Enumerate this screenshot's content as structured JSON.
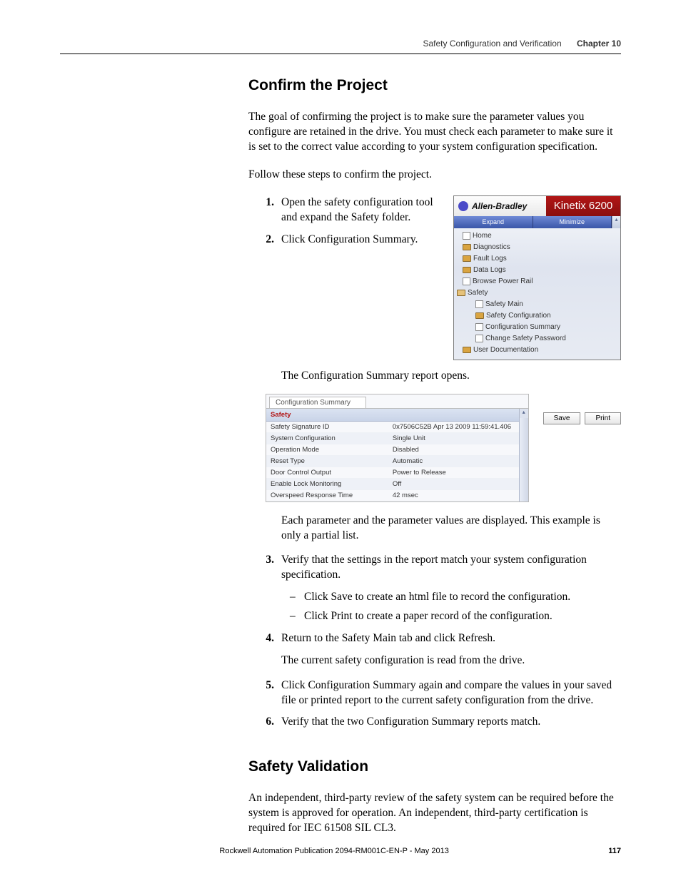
{
  "header": {
    "title": "Safety Configuration and Verification",
    "chapter": "Chapter 10"
  },
  "section1": {
    "heading": "Confirm the Project",
    "intro": "The goal of confirming the project is to make sure the parameter values you configure are retained in the drive. You must check each parameter to make sure it is set to the correct value according to your system configuration specification.",
    "follow": "Follow these steps to confirm the project."
  },
  "steps_top": {
    "s1": {
      "num": "1.",
      "text": "Open the safety configuration tool and expand the Safety folder."
    },
    "s2": {
      "num": "2.",
      "text": "Click Configuration Summary."
    }
  },
  "nav": {
    "brand_left": "Allen-Bradley",
    "brand_right": "Kinetix 6200",
    "tab_expand": "Expand",
    "tab_minimize": "Minimize",
    "items": {
      "home": "Home",
      "diag": "Diagnostics",
      "fault": "Fault Logs",
      "data": "Data Logs",
      "browse": "Browse Power Rail",
      "safety": "Safety",
      "safety_main": "Safety Main",
      "safety_cfg": "Safety Configuration",
      "cfg_sum": "Configuration Summary",
      "chg_pw": "Change Safety Password",
      "userdoc": "User Documentation"
    }
  },
  "mid": {
    "report_opens": "The Configuration Summary report opens."
  },
  "cfg": {
    "tab_label": "Configuration Summary",
    "category": "Safety",
    "rows": {
      "r0": {
        "k": "Safety Signature ID",
        "v": "0x7506C52B Apr 13 2009 11:59:41.406"
      },
      "r1": {
        "k": "System Configuration",
        "v": "Single Unit"
      },
      "r2": {
        "k": "Operation Mode",
        "v": "Disabled"
      },
      "r3": {
        "k": "Reset Type",
        "v": "Automatic"
      },
      "r4": {
        "k": "Door Control Output",
        "v": "Power to Release"
      },
      "r5": {
        "k": "Enable Lock Monitoring",
        "v": "Off"
      },
      "r6": {
        "k": "Overspeed Response Time",
        "v": "42 msec"
      }
    },
    "save_btn": "Save",
    "print_btn": "Print"
  },
  "after_cfg": {
    "partial": "Each parameter and the parameter values are displayed. This example is only a partial list."
  },
  "steps_bottom": {
    "s3": {
      "num": "3.",
      "text": "Verify that the settings in the report match your system configuration specification."
    },
    "d1": "Click Save to create an html file to record the configuration.",
    "d2": "Click Print to create a paper record of the configuration.",
    "s4": {
      "num": "4.",
      "text": "Return to the Safety Main tab and click Refresh."
    },
    "s4_after": "The current safety configuration is read from the drive.",
    "s5": {
      "num": "5.",
      "text": "Click Configuration Summary again and compare the values in your saved file or printed report to the current safety configuration from the drive."
    },
    "s6": {
      "num": "6.",
      "text": "Verify that the two Configuration Summary reports match."
    }
  },
  "section2": {
    "heading": "Safety Validation",
    "para": "An independent, third-party review of the safety system can be required before the system is approved for operation. An independent, third-party certification is required for IEC 61508 SIL CL3."
  },
  "footer": {
    "pub": "Rockwell Automation Publication 2094-RM001C-EN-P - May 2013",
    "page": "117"
  },
  "dash": "–"
}
